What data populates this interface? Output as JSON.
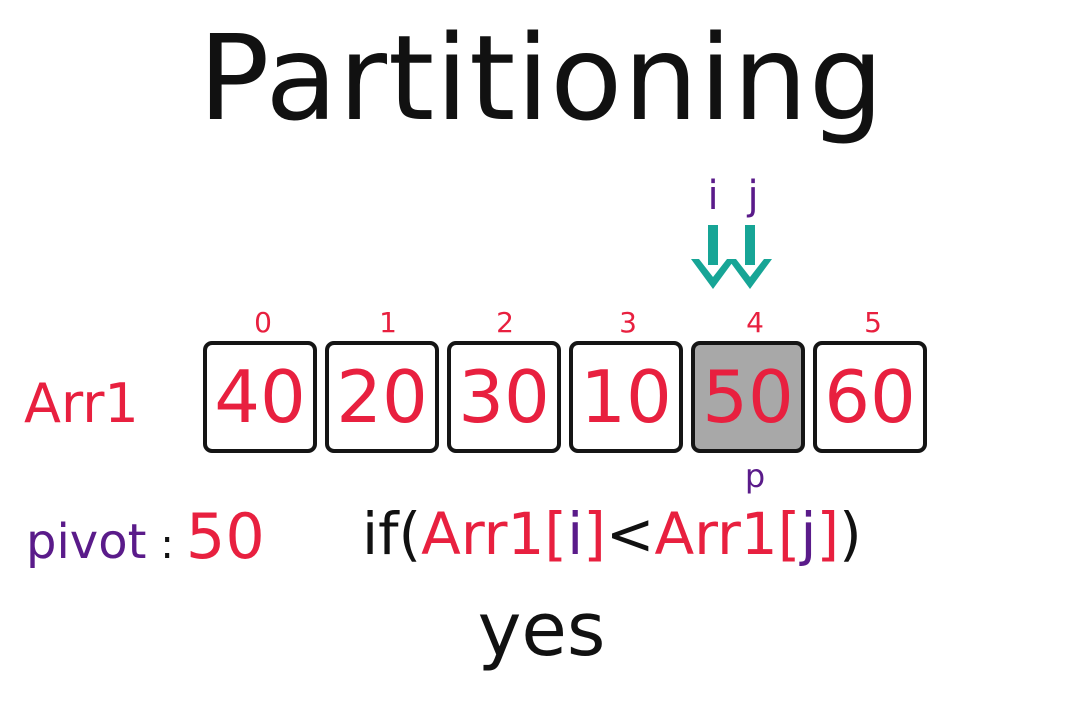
{
  "title": "Partitioning",
  "pointers": {
    "i_label": "i",
    "j_label": "j",
    "arrow_color": "#17a596"
  },
  "array": {
    "name": "Arr1",
    "indices": [
      "0",
      "1",
      "2",
      "3",
      "4",
      "5"
    ],
    "values": [
      "40",
      "20",
      "30",
      "10",
      "50",
      "60"
    ],
    "highlighted_index": 4,
    "pivot_marker": "p"
  },
  "pivot": {
    "label": "pivot",
    "colon": ":",
    "value": "50"
  },
  "condition": {
    "open": "if(",
    "left": "Arr1[",
    "left_index": "i",
    "left_close": "]",
    "operator": "<",
    "right": "Arr1[",
    "right_index": "j",
    "right_close": "]",
    "close": ")"
  },
  "result": "yes",
  "colors": {
    "red": "#e8203f",
    "purple": "#5a1b8a",
    "teal": "#17a596",
    "pivot_cell_bg": "#a8a8a8"
  }
}
